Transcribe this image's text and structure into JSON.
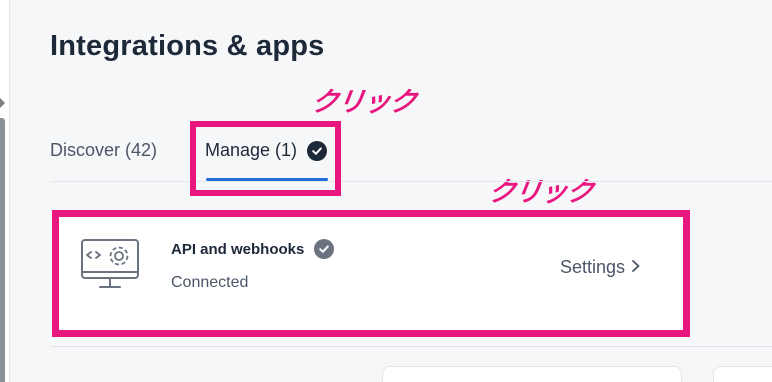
{
  "header": {
    "title": "Integrations & apps"
  },
  "annotations": {
    "tab_click": "クリック",
    "card_click": "クリック"
  },
  "tabs": [
    {
      "label": "Discover (42)",
      "selected": false
    },
    {
      "label": "Manage (1)",
      "selected": true,
      "icon": "check-circle-icon"
    }
  ],
  "integration": {
    "icon": "code-settings-monitor-icon",
    "title": "API and webhooks",
    "title_icon": "check-circle-icon",
    "status": "Connected",
    "settings_label": "Settings",
    "settings_icon": "chevron-right-icon"
  },
  "colors": {
    "accent_blue": "#1f6fd6",
    "annotation_pink": "#e8177f",
    "title_text": "#1d2939",
    "muted_text": "#4b5668"
  }
}
